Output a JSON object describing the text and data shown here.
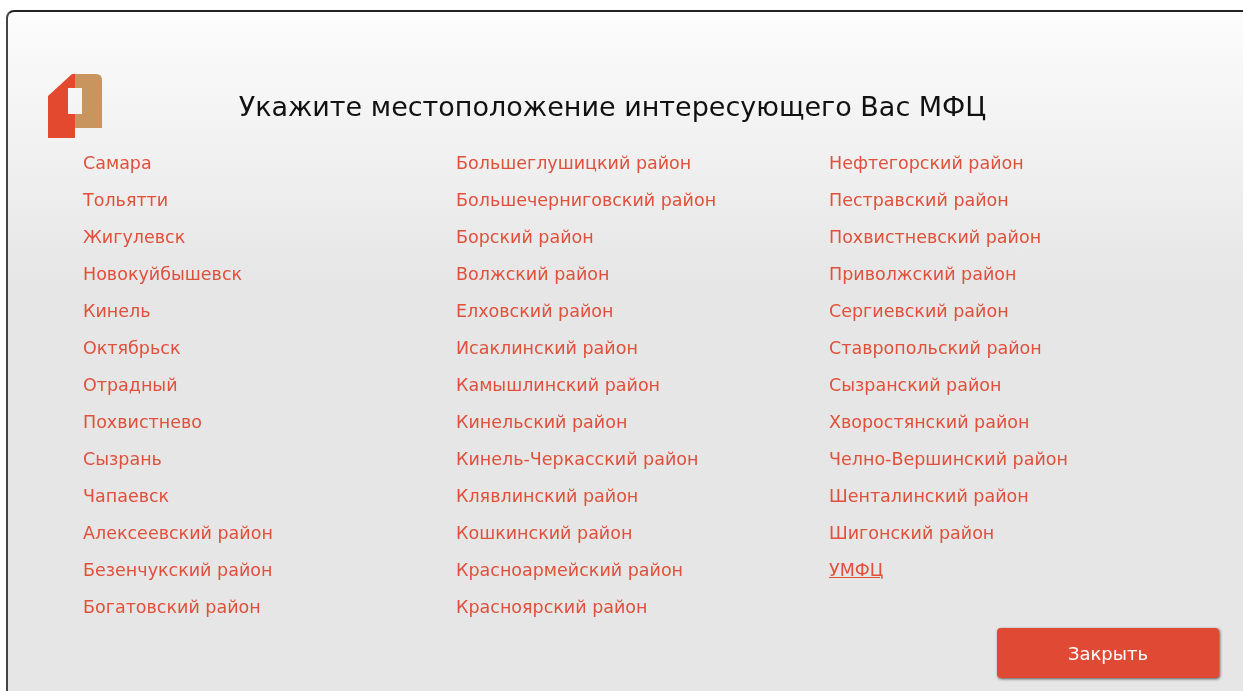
{
  "dialog": {
    "title": "Укажите местоположение интересующего Вас МФЦ",
    "columns": [
      [
        {
          "label": "Самара",
          "underlined": false
        },
        {
          "label": "Тольятти",
          "underlined": false
        },
        {
          "label": "Жигулевск",
          "underlined": false
        },
        {
          "label": "Новокуйбышевск",
          "underlined": false
        },
        {
          "label": "Кинель",
          "underlined": false
        },
        {
          "label": "Октябрьск",
          "underlined": false
        },
        {
          "label": "Отрадный",
          "underlined": false
        },
        {
          "label": "Похвистнево",
          "underlined": false
        },
        {
          "label": "Сызрань",
          "underlined": false
        },
        {
          "label": "Чапаевск",
          "underlined": false
        },
        {
          "label": "Алексеевский район",
          "underlined": false
        },
        {
          "label": "Безенчукский район",
          "underlined": false
        },
        {
          "label": "Богатовский район",
          "underlined": false
        }
      ],
      [
        {
          "label": "Большеглушицкий район",
          "underlined": false
        },
        {
          "label": "Большечерниговский район",
          "underlined": false
        },
        {
          "label": "Борский район",
          "underlined": false
        },
        {
          "label": "Волжский район",
          "underlined": false
        },
        {
          "label": "Елховский район",
          "underlined": false
        },
        {
          "label": "Исаклинский район",
          "underlined": false
        },
        {
          "label": "Камышлинский район",
          "underlined": false
        },
        {
          "label": "Кинельский район",
          "underlined": false
        },
        {
          "label": "Кинель-Черкасский район",
          "underlined": false
        },
        {
          "label": "Клявлинский район",
          "underlined": false
        },
        {
          "label": "Кошкинский район",
          "underlined": false
        },
        {
          "label": "Красноармейский район",
          "underlined": false
        },
        {
          "label": "Красноярский район",
          "underlined": false
        }
      ],
      [
        {
          "label": "Нефтегорский район",
          "underlined": false
        },
        {
          "label": "Пестравский район",
          "underlined": false
        },
        {
          "label": "Похвистневский район",
          "underlined": false
        },
        {
          "label": "Приволжский район",
          "underlined": false
        },
        {
          "label": "Сергиевский район",
          "underlined": false
        },
        {
          "label": "Ставропольский район",
          "underlined": false
        },
        {
          "label": "Сызранский район",
          "underlined": false
        },
        {
          "label": "Хворостянский район",
          "underlined": false
        },
        {
          "label": "Челно-Вершинский район",
          "underlined": false
        },
        {
          "label": "Шенталинский район",
          "underlined": false
        },
        {
          "label": "Шигонский район",
          "underlined": false
        },
        {
          "label": "УМФЦ",
          "underlined": true
        }
      ]
    ],
    "close_button": "Закрыть"
  }
}
